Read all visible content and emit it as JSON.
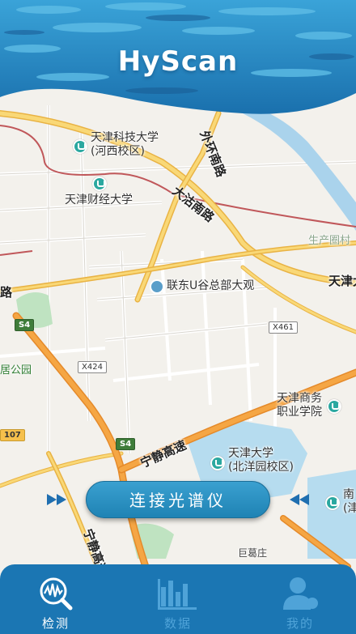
{
  "header": {
    "title": "HyScan"
  },
  "map": {
    "pois": [
      {
        "name": "天津科技大学\n(河西校区)",
        "line1": "天津科技大学",
        "line2": "(河西校区)"
      },
      {
        "name": "天津财经大学"
      },
      {
        "name": "联东U谷总部大观"
      },
      {
        "line1": "天津商务",
        "line2": "职业学院"
      },
      {
        "line1": "天津大学",
        "line2": "(北洋园校区)"
      }
    ],
    "roads": {
      "waihuan": "外环南路",
      "dagu": "大沽南路",
      "ningjing": "宁静高速",
      "ningjing2": "宁静高速",
      "tianjin_right": "天津大",
      "lu_left": "路"
    },
    "places": {
      "shengchanquan": "生产圈村",
      "park": "居公园",
      "jugezhuang": "巨葛庄",
      "nan": "南",
      "jin": "(津"
    },
    "shields": {
      "s4a": "S4",
      "s4b": "S4",
      "x461": "X461",
      "x424": "X424",
      "x107": "107"
    }
  },
  "actions": {
    "connect_label": "连接光谱仪"
  },
  "tabs": [
    {
      "label": "检测",
      "icon": "spectrum-search-icon",
      "active": true
    },
    {
      "label": "数据",
      "icon": "bar-chart-icon",
      "active": false
    },
    {
      "label": "我的",
      "icon": "user-profile-icon",
      "active": false
    }
  ],
  "colors": {
    "header_blue": "#1a78b8",
    "tab_bar": "#1b76b3",
    "button": "#2a92c3",
    "tab_inactive": "#4fa3d8"
  }
}
